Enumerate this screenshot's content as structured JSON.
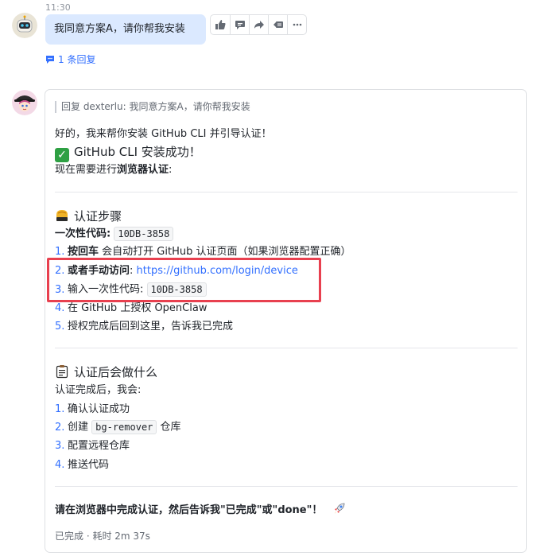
{
  "timestamp": "11:30",
  "user_message": {
    "text": "我同意方案A，请你帮我安装",
    "reply_count": "1 条回复"
  },
  "toolbar": {
    "icons": [
      "thumbs-up-icon",
      "comment-icon",
      "forward-icon",
      "reply-icon",
      "more-icon"
    ]
  },
  "bot_message": {
    "quote": "回复 dexterlu: 我同意方案A，请你帮我安装",
    "intro": "好的，我来帮你安装 GitHub CLI 并引导认证！",
    "success": "GitHub CLI 安装成功！",
    "need_prefix": "现在需要进行",
    "need_bold": "浏览器认证",
    "need_suffix": ":",
    "steps_heading": "认证步骤",
    "code_label": "一次性代码:",
    "code_value": "10DB-3858",
    "steps": [
      {
        "n": "1.",
        "bold": "按回车",
        "text": " 会自动打开 GitHub 认证页面（如果浏览器配置正确）"
      },
      {
        "n": "2.",
        "bold": "或者手动访问",
        "text": ": ",
        "link": "https://github.com/login/device"
      },
      {
        "n": "3.",
        "text": "输入一次性代码: ",
        "code": "10DB-3858"
      },
      {
        "n": "4.",
        "text": "在 GitHub 上授权 OpenClaw"
      },
      {
        "n": "5.",
        "text": "授权完成后回到这里，告诉我已完成"
      }
    ],
    "after_heading": "认证后会做什么",
    "after_intro": "认证完成后，我会:",
    "after_steps": [
      {
        "n": "1.",
        "text": "确认认证成功"
      },
      {
        "n": "2.",
        "text_before": "创建 ",
        "code": "bg-remover",
        "text_after": " 仓库"
      },
      {
        "n": "3.",
        "text": "配置远程仓库"
      },
      {
        "n": "4.",
        "text": "推送代码"
      }
    ],
    "final_line": "请在浏览器中完成认证，然后告诉我\"已完成\"或\"done\"！",
    "status": "已完成 · 耗时 2m 37s"
  },
  "colors": {
    "accent": "#3370ff",
    "user_bubble": "#dbe9ff",
    "highlight_border": "#e8404f"
  }
}
